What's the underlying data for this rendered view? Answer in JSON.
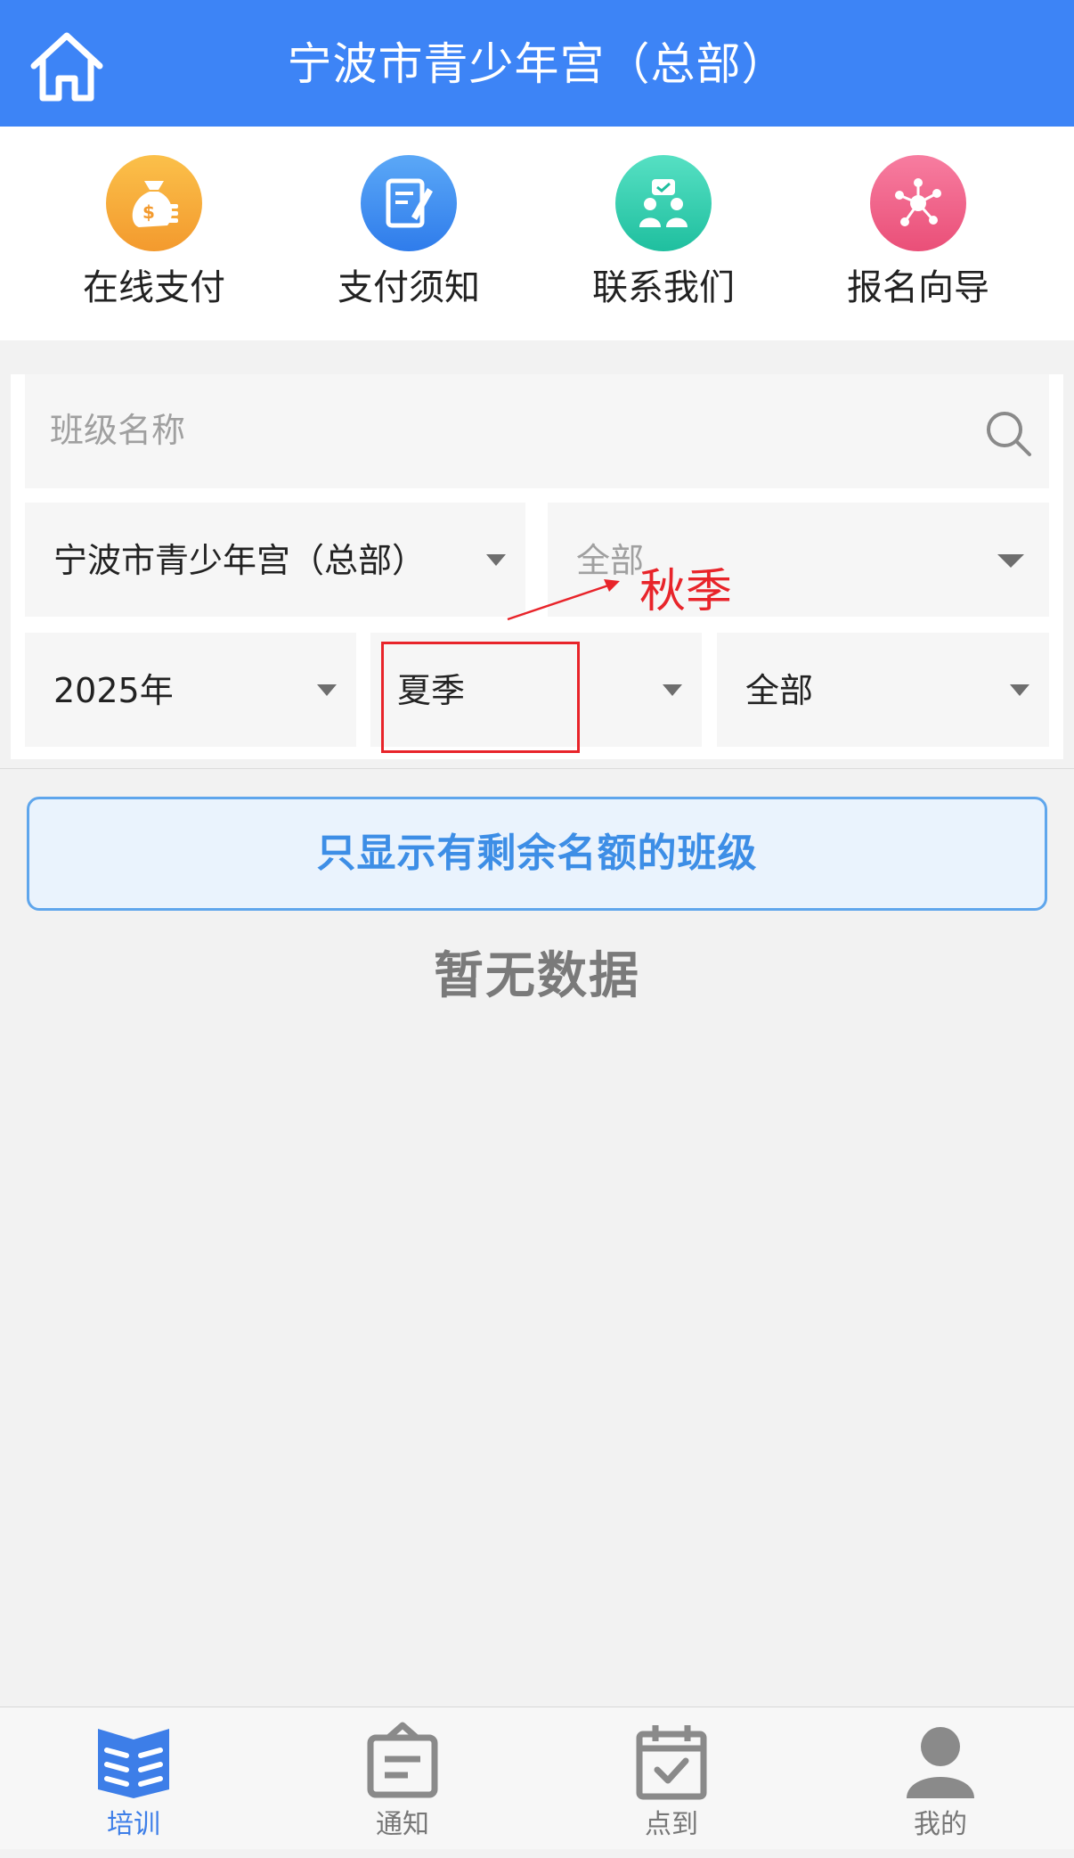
{
  "header": {
    "title": "宁波市青少年宫（总部）",
    "home_icon": "home-icon"
  },
  "quick_menu": [
    {
      "label": "在线支付",
      "icon": "money-bag-icon",
      "color": "#f7a035"
    },
    {
      "label": "支付须知",
      "icon": "document-edit-icon",
      "color": "#3f8df3"
    },
    {
      "label": "联系我们",
      "icon": "contact-people-icon",
      "color": "#33cfb0"
    },
    {
      "label": "报名向导",
      "icon": "network-nodes-icon",
      "color": "#f0577f"
    }
  ],
  "filters": {
    "search_placeholder": "班级名称",
    "campus": "宁波市青少年宫（总部）",
    "category_placeholder": "全部",
    "year": "2025年",
    "season": "夏季",
    "level": "全部"
  },
  "annotation": {
    "text": "秋季",
    "color": "#e8242a"
  },
  "only_remaining_label": "只显示有剩余名额的班级",
  "empty_text": "暂无数据",
  "tabs": [
    {
      "label": "培训",
      "icon": "book-icon",
      "active": true
    },
    {
      "label": "通知",
      "icon": "notice-icon",
      "active": false
    },
    {
      "label": "点到",
      "icon": "calendar-check-icon",
      "active": false
    },
    {
      "label": "我的",
      "icon": "user-icon",
      "active": false
    }
  ],
  "colors": {
    "primary": "#3d84f6",
    "accent_text": "#3d8ee6",
    "annotation_red": "#e8242a"
  }
}
